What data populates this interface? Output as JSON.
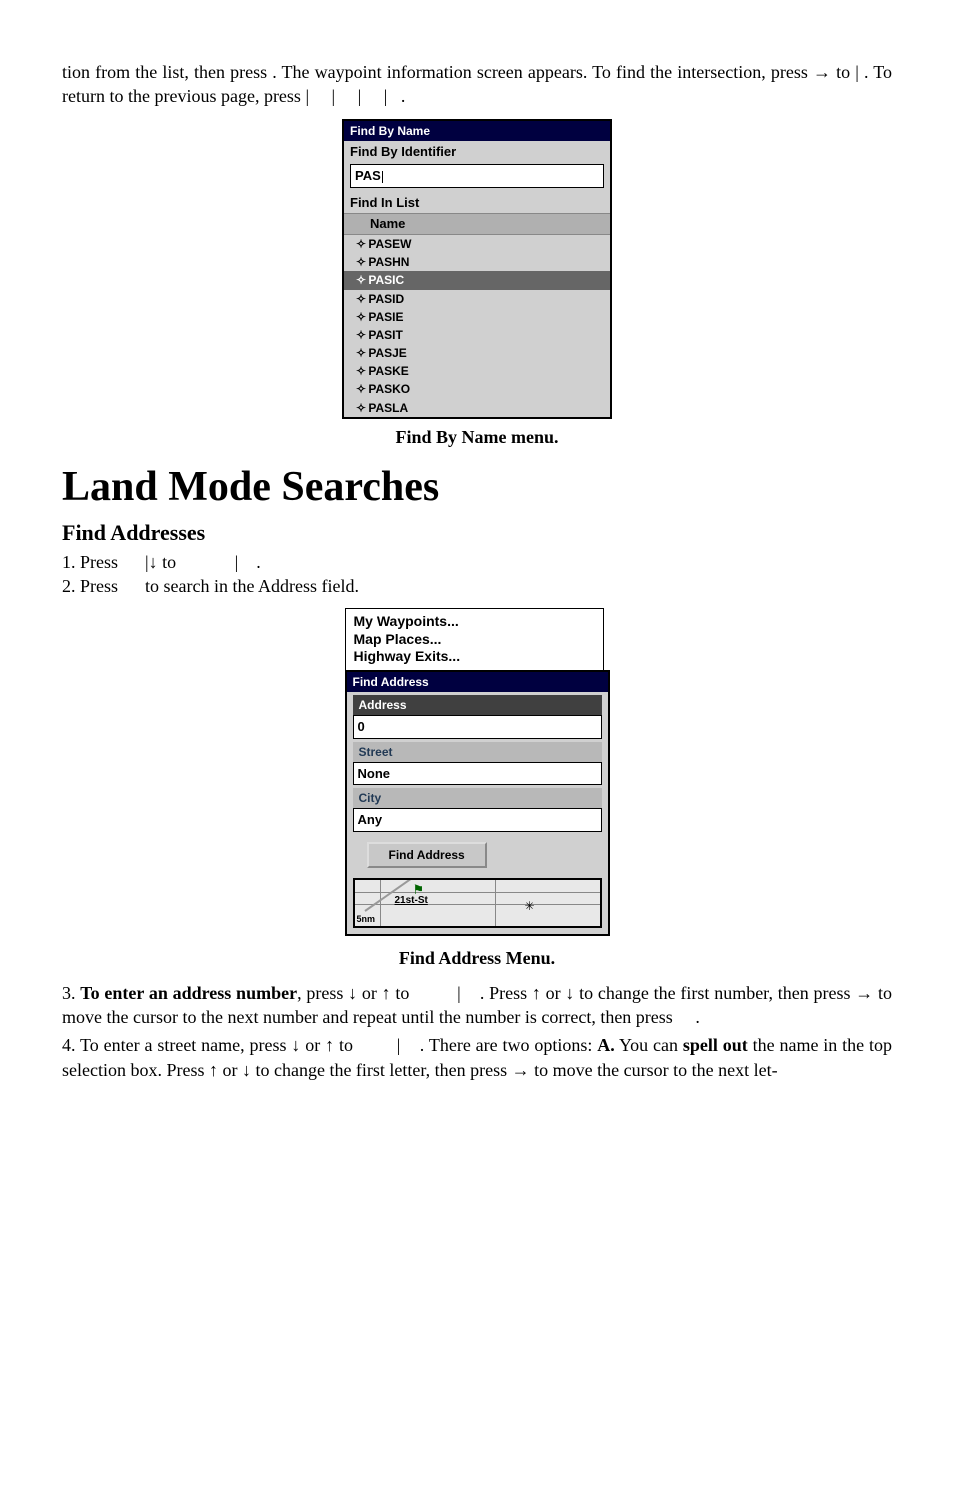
{
  "intro": {
    "p1a": "tion from the list, then press ",
    "p1b": ". The waypoint information screen appears. To find the intersection, press → to ",
    "p1c": "|",
    "p1d": ". To return to the previous page, press ",
    "p1e": "|",
    "p1f": "|",
    "p1g": "|",
    "p1h": "|",
    "p1i": "."
  },
  "dlg1": {
    "title": "Find By Name",
    "sec_identifier": "Find By Identifier",
    "identifier_value": "PAS",
    "sec_list": "Find In List",
    "col_name": "Name",
    "rows": [
      {
        "name": "PASEW",
        "sel": false
      },
      {
        "name": "PASHN",
        "sel": false
      },
      {
        "name": "PASIC",
        "sel": true
      },
      {
        "name": "PASID",
        "sel": false
      },
      {
        "name": "PASIE",
        "sel": false
      },
      {
        "name": "PASIT",
        "sel": false
      },
      {
        "name": "PASJE",
        "sel": false
      },
      {
        "name": "PASKE",
        "sel": false
      },
      {
        "name": "PASKO",
        "sel": false
      },
      {
        "name": "PASLA",
        "sel": false
      }
    ]
  },
  "cap1": "Find By Name menu.",
  "h1": "Land Mode Searches",
  "h2": "Find Addresses",
  "steps12": {
    "s1a": "1. Press ",
    "s1b": "|↓ to ",
    "s1c": "|",
    "s1d": ".",
    "s2a": "2. Press ",
    "s2b": " to search in the Address field."
  },
  "dlg2": {
    "menu1": "My Waypoints...",
    "menu2": "Map Places...",
    "menu3": "Highway Exits...",
    "title": "Find Address",
    "addr_label": "Address",
    "addr_value": "0",
    "street_label": "Street",
    "street_value": "None",
    "city_label": "City",
    "city_value": "Any",
    "button": "Find Address",
    "map_corner": "5nm",
    "map_street": "21st-St"
  },
  "cap2": "Find Address Menu.",
  "steps34": {
    "s3a": "3. ",
    "s3b": "To enter an address number",
    "s3c": ", press ↓ or ↑ to ",
    "s3d": "|",
    "s3e": ". Press ↑ or ↓ to change the first number, then press → to move the cursor to the next number and repeat until the number is correct, then press ",
    "s3f": ".",
    "s4a": "4. To enter a street name, press ↓ or ↑ to ",
    "s4b": "|",
    "s4c": ". There are two options: ",
    "s4d": "A.",
    "s4e": " You can ",
    "s4f": "spell out",
    "s4g": " the name in the top selection box. Press ↑ or ↓ to change the first letter, then press → to move the cursor to the next let-"
  }
}
